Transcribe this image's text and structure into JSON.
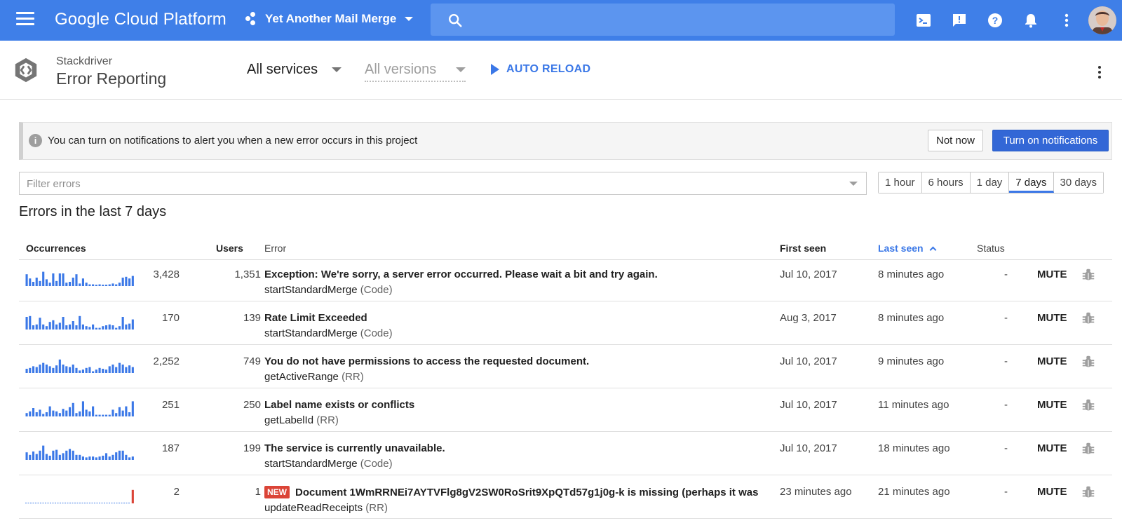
{
  "topbar": {
    "brand": "Google Cloud Platform",
    "project": "Yet Another Mail Merge",
    "search_placeholder": ""
  },
  "appbar": {
    "product_sub": "Stackdriver",
    "product_title": "Error Reporting",
    "services_selected": "All services",
    "versions_selected": "All versions",
    "auto_reload": "AUTO RELOAD"
  },
  "banner": {
    "message": "You can turn on notifications to alert you when a new error occurs in this project",
    "not_now": "Not now",
    "turn_on": "Turn on notifications"
  },
  "filter": {
    "placeholder": "Filter errors"
  },
  "ranges": [
    "1 hour",
    "6 hours",
    "1 day",
    "7 days",
    "30 days"
  ],
  "active_range": "7 days",
  "heading": "Errors in the last 7 days",
  "columns": {
    "occurrences": "Occurrences",
    "users": "Users",
    "error": "Error",
    "first_seen": "First seen",
    "last_seen": "Last seen",
    "status": "Status"
  },
  "colors": {
    "topbar": "#3f7fe8",
    "accent": "#3b78e7",
    "new_badge": "#db4437",
    "spark": "#3b78e7"
  },
  "rows": [
    {
      "occurrences": "3,428",
      "users": "1,351",
      "title": "Exception: We're sorry, a server error occurred. Please wait a bit and try again.",
      "function": "startStandardMerge",
      "tag": "(Code)",
      "first_seen": "Jul 10, 2017",
      "last_seen": "8 minutes ago",
      "status": "-",
      "mute": "MUTE",
      "is_new": false,
      "spark": [
        0.7,
        0.45,
        0.25,
        0.5,
        0.3,
        0.85,
        0.4,
        0.2,
        0.75,
        0.3,
        0.75,
        0.75,
        0.2,
        0.25,
        0.5,
        0.7,
        0.15,
        0.45,
        0.2,
        0.1,
        0.1,
        0.08,
        0.1,
        0.08,
        0.08,
        0.1,
        0.15,
        0.1,
        0.2,
        0.5,
        0.55,
        0.45,
        0.6
      ]
    },
    {
      "occurrences": "170",
      "users": "139",
      "title": "Rate Limit Exceeded",
      "function": "startStandardMerge",
      "tag": "(Code)",
      "first_seen": "Aug 3, 2017",
      "last_seen": "8 minutes ago",
      "status": "-",
      "mute": "MUTE",
      "is_new": false,
      "spark": [
        0.75,
        0.8,
        0.25,
        0.3,
        0.7,
        0.3,
        0.2,
        0.45,
        0.55,
        0.3,
        0.4,
        0.75,
        0.25,
        0.3,
        0.5,
        0.25,
        0.8,
        0.3,
        0.2,
        0.15,
        0.3,
        0.1,
        0.1,
        0.2,
        0.25,
        0.3,
        0.25,
        0.1,
        0.2,
        0.75,
        0.3,
        0.35,
        0.6
      ]
    },
    {
      "occurrences": "2,252",
      "users": "749",
      "title": "You do not have permissions to access the requested document.",
      "function": "getActiveRange",
      "tag": "(RR)",
      "first_seen": "Jul 10, 2017",
      "last_seen": "9 minutes ago",
      "status": "-",
      "mute": "MUTE",
      "is_new": false,
      "spark": [
        0.25,
        0.3,
        0.4,
        0.35,
        0.5,
        0.6,
        0.5,
        0.4,
        0.3,
        0.45,
        0.8,
        0.5,
        0.4,
        0.35,
        0.5,
        0.3,
        0.15,
        0.2,
        0.3,
        0.35,
        0.1,
        0.2,
        0.3,
        0.25,
        0.2,
        0.4,
        0.5,
        0.35,
        0.6,
        0.5,
        0.35,
        0.45,
        0.35
      ]
    },
    {
      "occurrences": "251",
      "users": "250",
      "title": "Label name exists or conflicts",
      "function": "getLabelId",
      "tag": "(RR)",
      "first_seen": "Jul 10, 2017",
      "last_seen": "11 minutes ago",
      "status": "-",
      "mute": "MUTE",
      "is_new": false,
      "spark": [
        0.2,
        0.3,
        0.5,
        0.25,
        0.4,
        0.15,
        0.25,
        0.6,
        0.35,
        0.3,
        0.2,
        0.45,
        0.35,
        0.55,
        0.8,
        0.2,
        0.3,
        0.9,
        0.4,
        0.3,
        0.6,
        0.1,
        0.1,
        0.1,
        0.1,
        0.1,
        0.4,
        0.2,
        0.55,
        0.35,
        0.6,
        0.25,
        0.9
      ]
    },
    {
      "occurrences": "187",
      "users": "199",
      "title": "The service is currently unavailable.",
      "function": "startStandardMerge",
      "tag": "(Code)",
      "first_seen": "Jul 10, 2017",
      "last_seen": "18 minutes ago",
      "status": "-",
      "mute": "MUTE",
      "is_new": false,
      "spark": [
        0.45,
        0.3,
        0.5,
        0.35,
        0.55,
        0.85,
        0.35,
        0.25,
        0.55,
        0.6,
        0.3,
        0.4,
        0.55,
        0.65,
        0.55,
        0.3,
        0.3,
        0.2,
        0.15,
        0.2,
        0.2,
        0.15,
        0.2,
        0.25,
        0.4,
        0.2,
        0.3,
        0.45,
        0.55,
        0.55,
        0.3,
        0.15,
        0.2
      ]
    },
    {
      "occurrences": "2",
      "users": "1",
      "title": "Document 1WmRRNEi7AYTVFlg8gV2SW0RoSrit9XpQTd57g1j0g-k is missing (perhaps it was",
      "function": "updateReadReceipts",
      "tag": "(RR)",
      "first_seen": "23 minutes ago",
      "last_seen": "21 minutes ago",
      "status": "-",
      "mute": "MUTE",
      "is_new": true,
      "new_label": "NEW",
      "spark": [
        0,
        0,
        0,
        0,
        0,
        0,
        0,
        0,
        0,
        0,
        0,
        0,
        0,
        0,
        0,
        0,
        0,
        0,
        0,
        0,
        0,
        0,
        0,
        0,
        0,
        0,
        0,
        0,
        0,
        0,
        0,
        0,
        0.8
      ]
    }
  ]
}
